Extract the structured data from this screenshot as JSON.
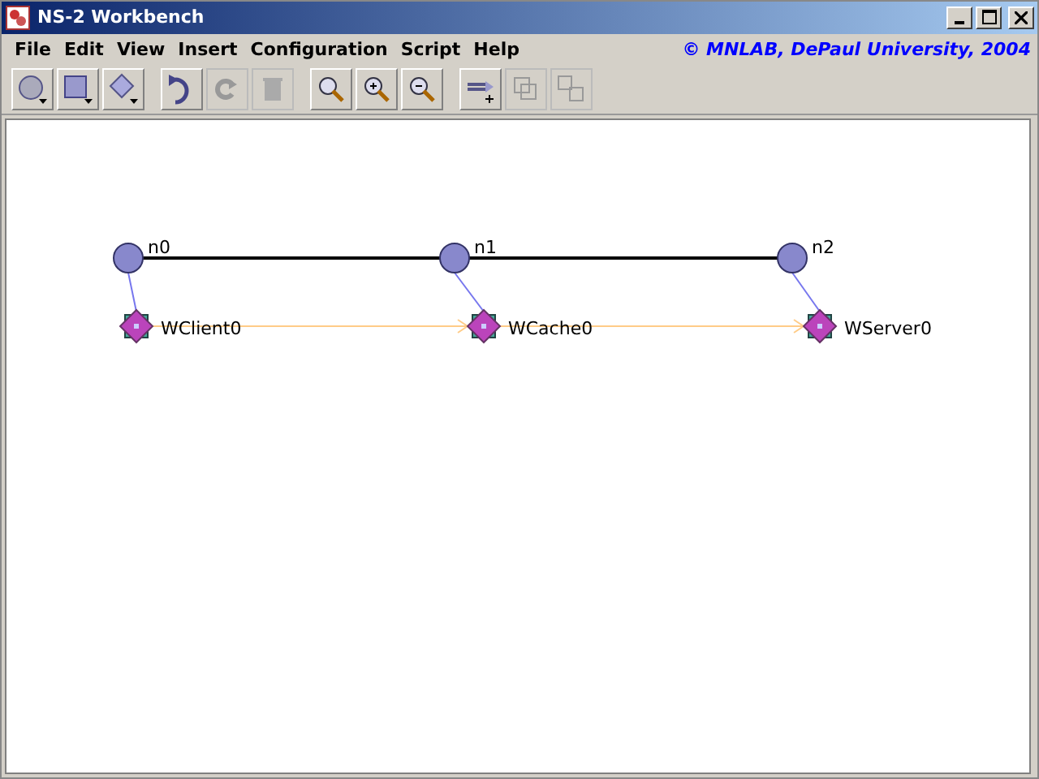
{
  "window": {
    "title": "NS-2 Workbench"
  },
  "menus": [
    "File",
    "Edit",
    "View",
    "Insert",
    "Configuration",
    "Script",
    "Help"
  ],
  "copyright": "© MNLAB, DePaul University, 2004",
  "toolbar": [
    [
      {
        "kind": "circle",
        "disabled": false
      },
      {
        "kind": "square",
        "disabled": false
      },
      {
        "kind": "diamond",
        "disabled": false
      }
    ],
    [
      {
        "kind": "undo",
        "disabled": false
      },
      {
        "kind": "redo",
        "disabled": true
      },
      {
        "kind": "trash",
        "disabled": true
      }
    ],
    [
      {
        "kind": "zoom",
        "disabled": false
      },
      {
        "kind": "zoom-in",
        "disabled": false
      },
      {
        "kind": "zoom-out",
        "disabled": false
      }
    ],
    [
      {
        "kind": "add-link",
        "disabled": false
      },
      {
        "kind": "group",
        "disabled": true
      },
      {
        "kind": "ungroup",
        "disabled": true
      }
    ]
  ],
  "canvas": {
    "nodes": [
      {
        "label": "n0",
        "agent": "WClient0"
      },
      {
        "label": "n1",
        "agent": "WCache0"
      },
      {
        "label": "n2",
        "agent": "WServer0"
      }
    ]
  }
}
